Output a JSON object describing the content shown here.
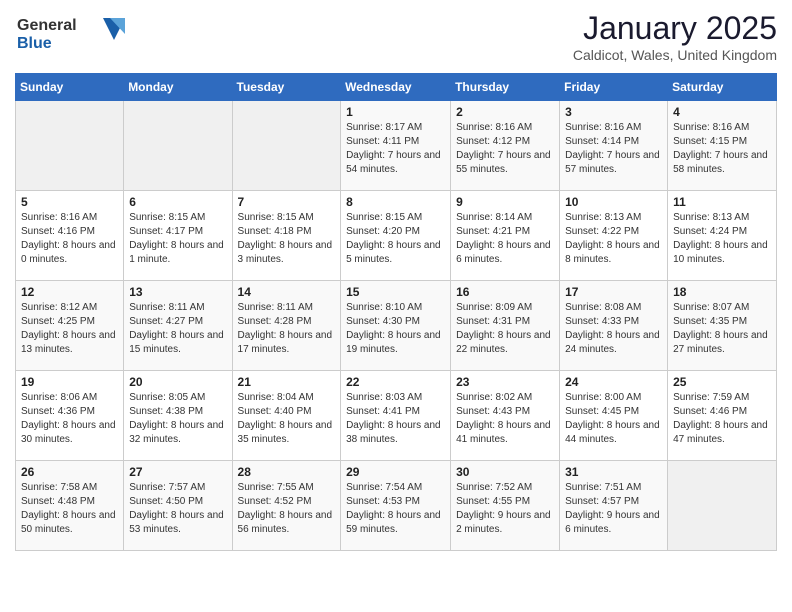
{
  "logo": {
    "general": "General",
    "blue": "Blue"
  },
  "header": {
    "title": "January 2025",
    "location": "Caldicot, Wales, United Kingdom"
  },
  "weekdays": [
    "Sunday",
    "Monday",
    "Tuesday",
    "Wednesday",
    "Thursday",
    "Friday",
    "Saturday"
  ],
  "weeks": [
    [
      {
        "day": "",
        "info": ""
      },
      {
        "day": "",
        "info": ""
      },
      {
        "day": "",
        "info": ""
      },
      {
        "day": "1",
        "info": "Sunrise: 8:17 AM\nSunset: 4:11 PM\nDaylight: 7 hours and 54 minutes."
      },
      {
        "day": "2",
        "info": "Sunrise: 8:16 AM\nSunset: 4:12 PM\nDaylight: 7 hours and 55 minutes."
      },
      {
        "day": "3",
        "info": "Sunrise: 8:16 AM\nSunset: 4:14 PM\nDaylight: 7 hours and 57 minutes."
      },
      {
        "day": "4",
        "info": "Sunrise: 8:16 AM\nSunset: 4:15 PM\nDaylight: 7 hours and 58 minutes."
      }
    ],
    [
      {
        "day": "5",
        "info": "Sunrise: 8:16 AM\nSunset: 4:16 PM\nDaylight: 8 hours and 0 minutes."
      },
      {
        "day": "6",
        "info": "Sunrise: 8:15 AM\nSunset: 4:17 PM\nDaylight: 8 hours and 1 minute."
      },
      {
        "day": "7",
        "info": "Sunrise: 8:15 AM\nSunset: 4:18 PM\nDaylight: 8 hours and 3 minutes."
      },
      {
        "day": "8",
        "info": "Sunrise: 8:15 AM\nSunset: 4:20 PM\nDaylight: 8 hours and 5 minutes."
      },
      {
        "day": "9",
        "info": "Sunrise: 8:14 AM\nSunset: 4:21 PM\nDaylight: 8 hours and 6 minutes."
      },
      {
        "day": "10",
        "info": "Sunrise: 8:13 AM\nSunset: 4:22 PM\nDaylight: 8 hours and 8 minutes."
      },
      {
        "day": "11",
        "info": "Sunrise: 8:13 AM\nSunset: 4:24 PM\nDaylight: 8 hours and 10 minutes."
      }
    ],
    [
      {
        "day": "12",
        "info": "Sunrise: 8:12 AM\nSunset: 4:25 PM\nDaylight: 8 hours and 13 minutes."
      },
      {
        "day": "13",
        "info": "Sunrise: 8:11 AM\nSunset: 4:27 PM\nDaylight: 8 hours and 15 minutes."
      },
      {
        "day": "14",
        "info": "Sunrise: 8:11 AM\nSunset: 4:28 PM\nDaylight: 8 hours and 17 minutes."
      },
      {
        "day": "15",
        "info": "Sunrise: 8:10 AM\nSunset: 4:30 PM\nDaylight: 8 hours and 19 minutes."
      },
      {
        "day": "16",
        "info": "Sunrise: 8:09 AM\nSunset: 4:31 PM\nDaylight: 8 hours and 22 minutes."
      },
      {
        "day": "17",
        "info": "Sunrise: 8:08 AM\nSunset: 4:33 PM\nDaylight: 8 hours and 24 minutes."
      },
      {
        "day": "18",
        "info": "Sunrise: 8:07 AM\nSunset: 4:35 PM\nDaylight: 8 hours and 27 minutes."
      }
    ],
    [
      {
        "day": "19",
        "info": "Sunrise: 8:06 AM\nSunset: 4:36 PM\nDaylight: 8 hours and 30 minutes."
      },
      {
        "day": "20",
        "info": "Sunrise: 8:05 AM\nSunset: 4:38 PM\nDaylight: 8 hours and 32 minutes."
      },
      {
        "day": "21",
        "info": "Sunrise: 8:04 AM\nSunset: 4:40 PM\nDaylight: 8 hours and 35 minutes."
      },
      {
        "day": "22",
        "info": "Sunrise: 8:03 AM\nSunset: 4:41 PM\nDaylight: 8 hours and 38 minutes."
      },
      {
        "day": "23",
        "info": "Sunrise: 8:02 AM\nSunset: 4:43 PM\nDaylight: 8 hours and 41 minutes."
      },
      {
        "day": "24",
        "info": "Sunrise: 8:00 AM\nSunset: 4:45 PM\nDaylight: 8 hours and 44 minutes."
      },
      {
        "day": "25",
        "info": "Sunrise: 7:59 AM\nSunset: 4:46 PM\nDaylight: 8 hours and 47 minutes."
      }
    ],
    [
      {
        "day": "26",
        "info": "Sunrise: 7:58 AM\nSunset: 4:48 PM\nDaylight: 8 hours and 50 minutes."
      },
      {
        "day": "27",
        "info": "Sunrise: 7:57 AM\nSunset: 4:50 PM\nDaylight: 8 hours and 53 minutes."
      },
      {
        "day": "28",
        "info": "Sunrise: 7:55 AM\nSunset: 4:52 PM\nDaylight: 8 hours and 56 minutes."
      },
      {
        "day": "29",
        "info": "Sunrise: 7:54 AM\nSunset: 4:53 PM\nDaylight: 8 hours and 59 minutes."
      },
      {
        "day": "30",
        "info": "Sunrise: 7:52 AM\nSunset: 4:55 PM\nDaylight: 9 hours and 2 minutes."
      },
      {
        "day": "31",
        "info": "Sunrise: 7:51 AM\nSunset: 4:57 PM\nDaylight: 9 hours and 6 minutes."
      },
      {
        "day": "",
        "info": ""
      }
    ]
  ]
}
